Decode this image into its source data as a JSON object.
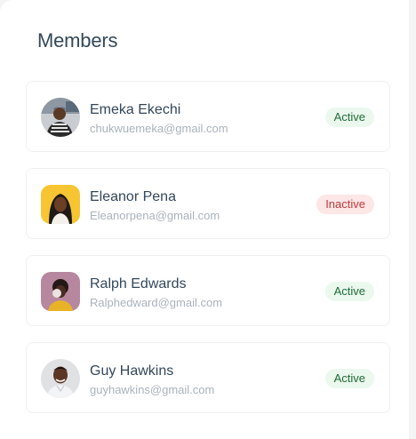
{
  "page": {
    "title": "Members"
  },
  "members": [
    {
      "name": "Emeka Ekechi",
      "email": "chukwuemeka@gmail.com",
      "status": "Active",
      "avatar_icon": "person-photo-avatar"
    },
    {
      "name": "Eleanor Pena",
      "email": "Eleanorpena@gmail.com",
      "status": "Inactive",
      "avatar_icon": "person-photo-avatar"
    },
    {
      "name": "Ralph Edwards",
      "email": "Ralphedward@gmail.com",
      "status": "Active",
      "avatar_icon": "person-photo-avatar"
    },
    {
      "name": "Guy Hawkins",
      "email": "guyhawkins@gmail.com",
      "status": "Active",
      "avatar_icon": "person-photo-avatar"
    }
  ],
  "colors": {
    "active_bg": "#ebf8ee",
    "active_text": "#1f6b35",
    "inactive_bg": "#fde6e6",
    "inactive_text": "#c13a3a",
    "title_text": "#34495a"
  }
}
